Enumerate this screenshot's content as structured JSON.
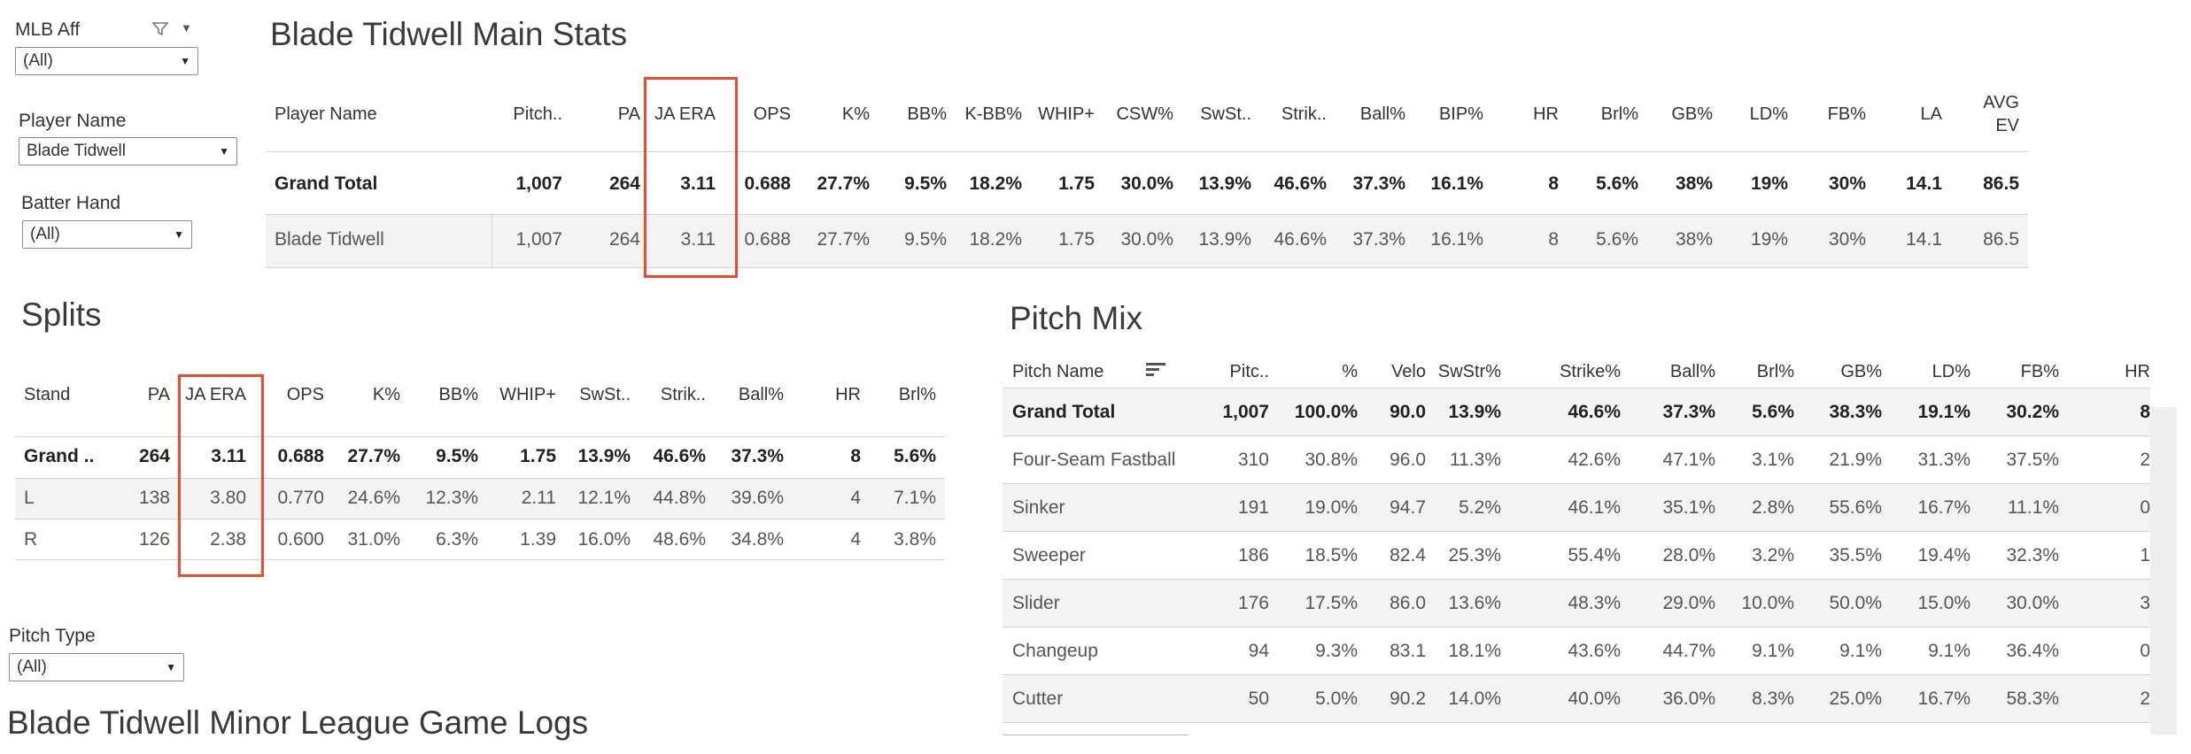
{
  "filters": {
    "mlb_aff": {
      "label": "MLB Aff",
      "value": "(All)"
    },
    "player_name": {
      "label": "Player Name",
      "value": "Blade Tidwell"
    },
    "batter_hand": {
      "label": "Batter Hand",
      "value": "(All)"
    },
    "pitch_type": {
      "label": "Pitch Type",
      "value": "(All)"
    }
  },
  "main_stats": {
    "title": "Blade Tidwell Main Stats",
    "columns": [
      "Player Name",
      "Pitch..",
      "PA",
      "JA ERA",
      "OPS",
      "K%",
      "BB%",
      "K-BB%",
      "WHIP+",
      "CSW%",
      "SwSt..",
      "Strik..",
      "Ball%",
      "BIP%",
      "HR",
      "Brl%",
      "GB%",
      "LD%",
      "FB%",
      "LA",
      "AVG EV"
    ],
    "rows": [
      [
        "Grand Total",
        "1,007",
        "264",
        "3.11",
        "0.688",
        "27.7%",
        "9.5%",
        "18.2%",
        "1.75",
        "30.0%",
        "13.9%",
        "46.6%",
        "37.3%",
        "16.1%",
        "8",
        "5.6%",
        "38%",
        "19%",
        "30%",
        "14.1",
        "86.5"
      ],
      [
        "Blade Tidwell",
        "1,007",
        "264",
        "3.11",
        "0.688",
        "27.7%",
        "9.5%",
        "18.2%",
        "1.75",
        "30.0%",
        "13.9%",
        "46.6%",
        "37.3%",
        "16.1%",
        "8",
        "5.6%",
        "38%",
        "19%",
        "30%",
        "14.1",
        "86.5"
      ]
    ]
  },
  "splits": {
    "title": "Splits",
    "columns": [
      "Stand",
      "PA",
      "JA ERA",
      "OPS",
      "K%",
      "BB%",
      "WHIP+",
      "SwSt..",
      "Strik..",
      "Ball%",
      "HR",
      "Brl%"
    ],
    "rows": [
      [
        "Grand ..",
        "264",
        "3.11",
        "0.688",
        "27.7%",
        "9.5%",
        "1.75",
        "13.9%",
        "46.6%",
        "37.3%",
        "8",
        "5.6%"
      ],
      [
        "L",
        "138",
        "3.80",
        "0.770",
        "24.6%",
        "12.3%",
        "2.11",
        "12.1%",
        "44.8%",
        "39.6%",
        "4",
        "7.1%"
      ],
      [
        "R",
        "126",
        "2.38",
        "0.600",
        "31.0%",
        "6.3%",
        "1.39",
        "16.0%",
        "48.6%",
        "34.8%",
        "4",
        "3.8%"
      ]
    ]
  },
  "pitch_mix": {
    "title": "Pitch Mix",
    "columns": [
      "Pitch Name",
      "Pitc..",
      "%",
      "Velo",
      "SwStr%",
      "Strike%",
      "Ball%",
      "Brl%",
      "GB%",
      "LD%",
      "FB%",
      "HR"
    ],
    "rows": [
      [
        "Grand Total",
        "1,007",
        "100.0%",
        "90.0",
        "13.9%",
        "46.6%",
        "37.3%",
        "5.6%",
        "38.3%",
        "19.1%",
        "30.2%",
        "8"
      ],
      [
        "Four-Seam Fastball",
        "310",
        "30.8%",
        "96.0",
        "11.3%",
        "42.6%",
        "47.1%",
        "3.1%",
        "21.9%",
        "31.3%",
        "37.5%",
        "2"
      ],
      [
        "Sinker",
        "191",
        "19.0%",
        "94.7",
        "5.2%",
        "46.1%",
        "35.1%",
        "2.8%",
        "55.6%",
        "16.7%",
        "11.1%",
        "0"
      ],
      [
        "Sweeper",
        "186",
        "18.5%",
        "82.4",
        "25.3%",
        "55.4%",
        "28.0%",
        "3.2%",
        "35.5%",
        "19.4%",
        "32.3%",
        "1"
      ],
      [
        "Slider",
        "176",
        "17.5%",
        "86.0",
        "13.6%",
        "48.3%",
        "29.0%",
        "10.0%",
        "50.0%",
        "15.0%",
        "30.0%",
        "3"
      ],
      [
        "Changeup",
        "94",
        "9.3%",
        "83.1",
        "18.1%",
        "43.6%",
        "44.7%",
        "9.1%",
        "9.1%",
        "9.1%",
        "36.4%",
        "0"
      ],
      [
        "Cutter",
        "50",
        "5.0%",
        "90.2",
        "14.0%",
        "40.0%",
        "36.0%",
        "8.3%",
        "25.0%",
        "16.7%",
        "58.3%",
        "2"
      ]
    ]
  },
  "game_logs": {
    "title": "Blade Tidwell Minor League Game Logs"
  },
  "colors": {
    "highlight": "#e84d2d",
    "band": "#f3f3f3"
  },
  "icons": [
    "filter-icon",
    "dropdown-caret-icon",
    "sort-icon"
  ]
}
